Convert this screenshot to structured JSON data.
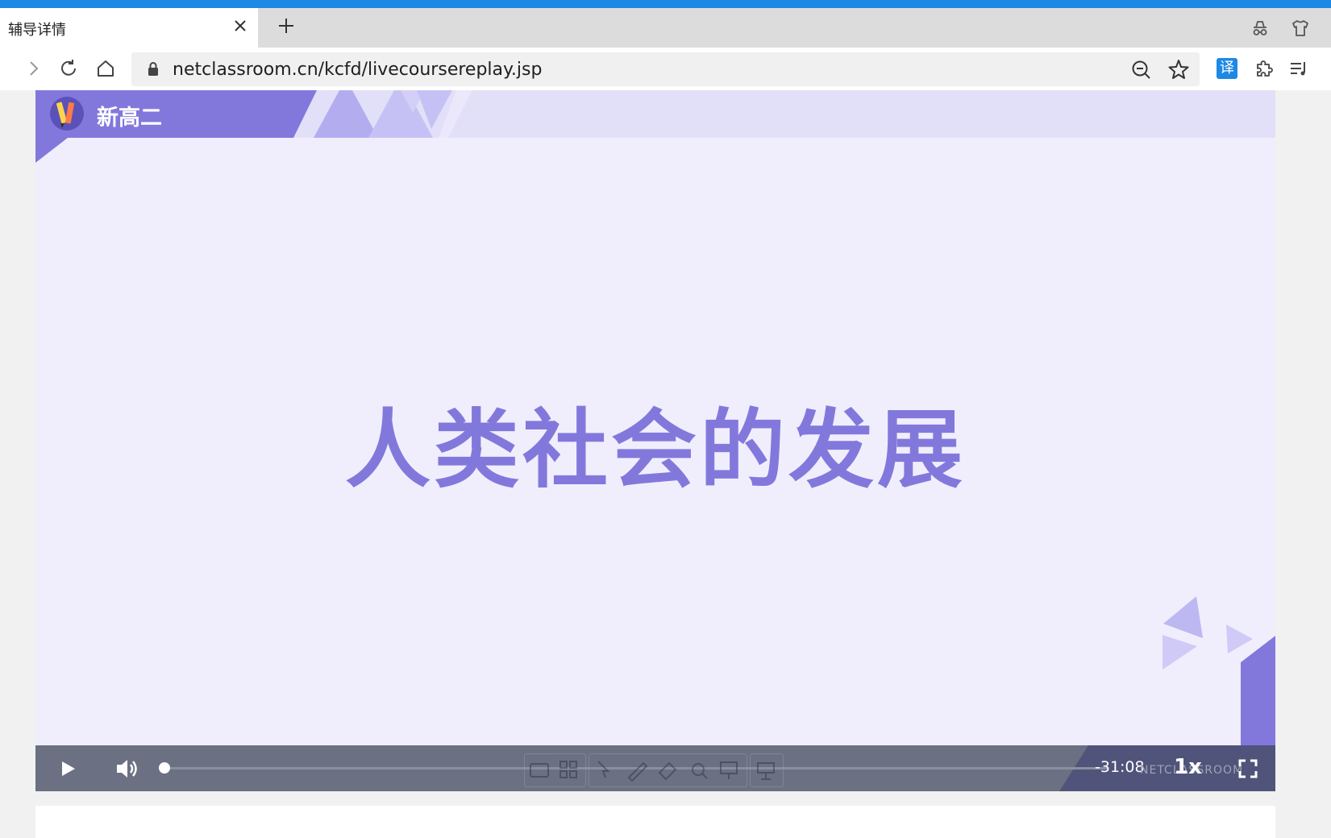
{
  "browser": {
    "tab_title": "辅导详情",
    "url": "netclassroom.cn/kcfd/livecoursereplay.jsp",
    "icons": {
      "tab_close": "close-icon",
      "new_tab": "plus-icon",
      "incognito": "incognito-icon",
      "shirt": "tshirt-icon",
      "forward": "chevron-right-icon",
      "reload": "reload-icon",
      "home": "home-icon",
      "lock": "lock-icon",
      "zoom": "zoom-out-icon",
      "bookmark": "star-icon",
      "translate": "translate-icon",
      "extensions": "puzzle-icon",
      "playlist": "playlist-icon"
    },
    "translate_label": "译"
  },
  "video": {
    "grade_label": "新高二",
    "slide_title": "人类社会的发展",
    "accent_color": "#8278dc",
    "player": {
      "time_remaining": "-31:08",
      "speed_label": "1x",
      "watermark": "NETCLASSROOM",
      "progress": 0.0
    }
  }
}
